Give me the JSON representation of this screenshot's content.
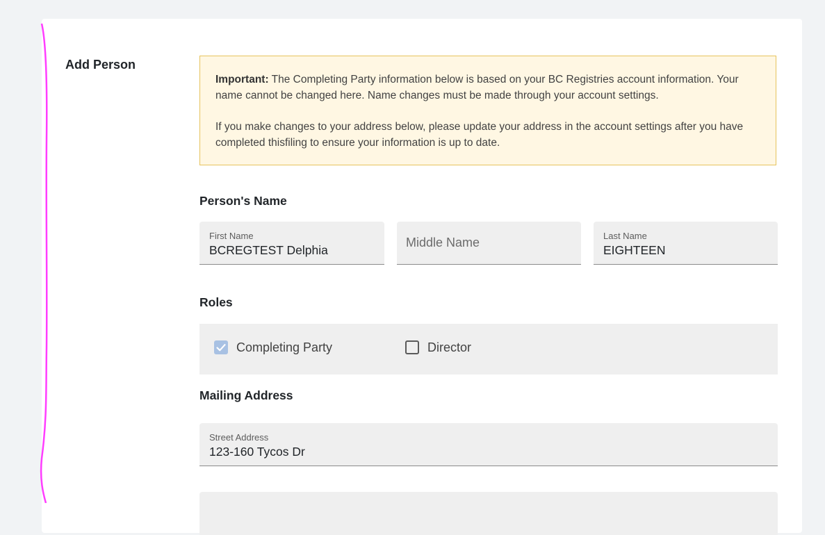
{
  "section": {
    "title": "Add Person"
  },
  "notice": {
    "important_label": "Important:",
    "line1": " The Completing Party information below is based on your BC Registries account information. Your name cannot be changed here. Name changes must be made through your account settings.",
    "line2": "If you make changes to your address below, please update your address in the account settings after you have completed thisfiling to ensure your information is up to date."
  },
  "person_name": {
    "heading": "Person's Name",
    "first_name": {
      "label": "First Name",
      "value": "BCREGTEST Delphia"
    },
    "middle_name": {
      "placeholder": "Middle Name"
    },
    "last_name": {
      "label": "Last Name",
      "value": "EIGHTEEN"
    }
  },
  "roles": {
    "heading": "Roles",
    "items": [
      {
        "label": "Completing Party",
        "checked": true
      },
      {
        "label": "Director",
        "checked": false
      }
    ]
  },
  "mailing_address": {
    "heading": "Mailing Address",
    "street": {
      "label": "Street Address",
      "value": "123-160 Tycos Dr"
    }
  },
  "colors": {
    "notice_bg": "#fff7e3",
    "notice_border": "#e6c35c",
    "checkbox_checked": "#a8c1e3",
    "annotation": "#ff3dff"
  }
}
